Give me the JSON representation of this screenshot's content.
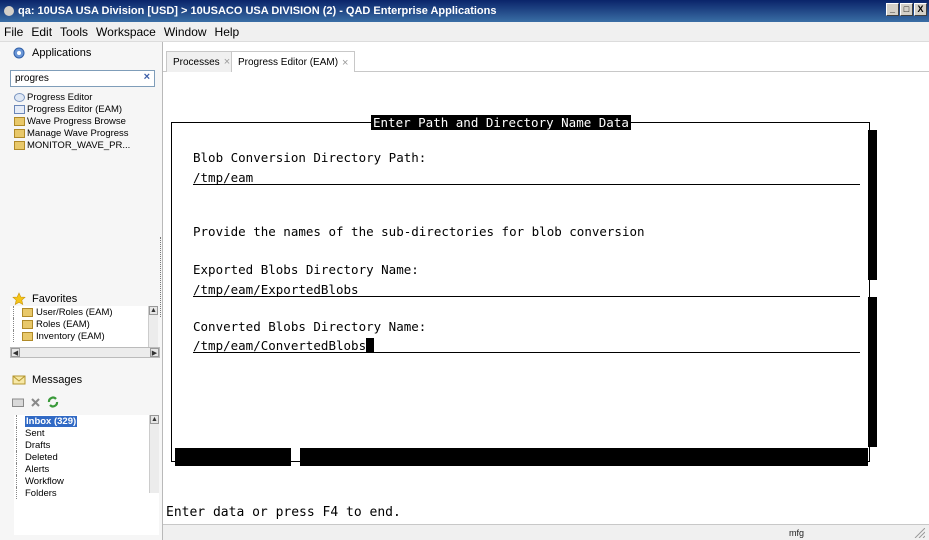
{
  "window": {
    "title": "qa: 10USA USA Division [USD] > 10USACO USA DIVISION (2) - QAD Enterprise Applications",
    "min_label": "_",
    "max_label": "□",
    "close_label": "X"
  },
  "menu": [
    "File",
    "Edit",
    "Tools",
    "Workspace",
    "Window",
    "Help"
  ],
  "applications": {
    "header": "Applications",
    "search_value": "progres",
    "search_clear": "×",
    "items": [
      {
        "label": "Progress Editor",
        "icon": "shortcut-icon"
      },
      {
        "label": "Progress Editor (EAM)",
        "icon": "document-icon"
      },
      {
        "label": "Wave Progress Browse",
        "icon": "folder-icon"
      },
      {
        "label": "Manage Wave Progress",
        "icon": "folder-icon"
      },
      {
        "label": "MONITOR_WAVE_PR...",
        "icon": "folder-icon"
      }
    ]
  },
  "favorites": {
    "header": "Favorites",
    "items": [
      "User/Roles (EAM)",
      "Roles (EAM)",
      "Inventory (EAM)"
    ]
  },
  "messages": {
    "header": "Messages",
    "items": [
      "Inbox (329)",
      "Sent",
      "Drafts",
      "Deleted",
      "Alerts",
      "Workflow",
      "Folders"
    ]
  },
  "tabs": [
    {
      "label": "Processes",
      "close": "×",
      "active": false
    },
    {
      "label": "Progress Editor (EAM)",
      "close": "×",
      "active": true
    }
  ],
  "terminal": {
    "frame_title": "Enter Path and Directory Name Data",
    "blob_label": "Blob Conversion Directory Path:",
    "blob_value": "/tmp/eam",
    "provide_text": "Provide the names of the sub-directories for blob conversion",
    "exported_label": "Exported Blobs Directory Name:",
    "exported_value": "/tmp/eam/ExportedBlobs",
    "converted_label": "Converted Blobs Directory Name:",
    "converted_value": "/tmp/eam/ConvertedBlobs",
    "status_line": "Enter data or press F4 to end."
  },
  "statusbar": {
    "user": "mfg"
  },
  "colors": {
    "titlebar": "#0a246a",
    "selection": "#316ac5",
    "terminal_text": "#000000"
  }
}
